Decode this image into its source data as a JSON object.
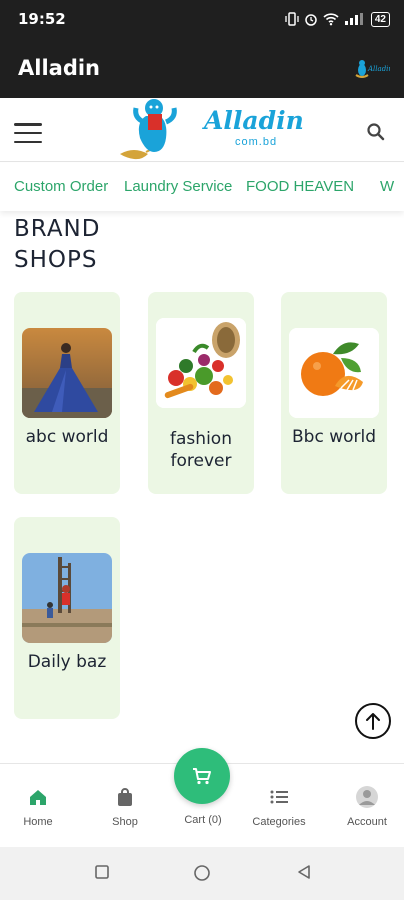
{
  "status_bar": {
    "time": "19:52",
    "battery": "42"
  },
  "app_bar": {
    "title": "Alladin"
  },
  "header": {
    "brand": "Alladin",
    "brand_sub": "com.bd"
  },
  "nav_strip": {
    "items": [
      "Custom Order",
      "Laundry Service",
      "FOOD HEAVEN",
      "W"
    ]
  },
  "section": {
    "title_line1": "BRAND",
    "title_line2": "SHOPS"
  },
  "shops": [
    {
      "name": "abc world",
      "icon": "gown-photo-icon"
    },
    {
      "name": "fashion forever",
      "icon": "vegetable-basket-icon"
    },
    {
      "name": "Bbc world",
      "icon": "orange-fruit-icon"
    },
    {
      "name": "Daily baz",
      "icon": "construction-photo-icon"
    }
  ],
  "bottom_nav": {
    "home": "Home",
    "shop": "Shop",
    "cart": "Cart (0)",
    "categories": "Categories",
    "account": "Account"
  },
  "colors": {
    "accent": "#2ca56a",
    "card_bg": "#ecf7e4",
    "fab": "#2ebd7a",
    "brand_blue": "#1aa3d9",
    "bar": "#1f1f1f"
  }
}
